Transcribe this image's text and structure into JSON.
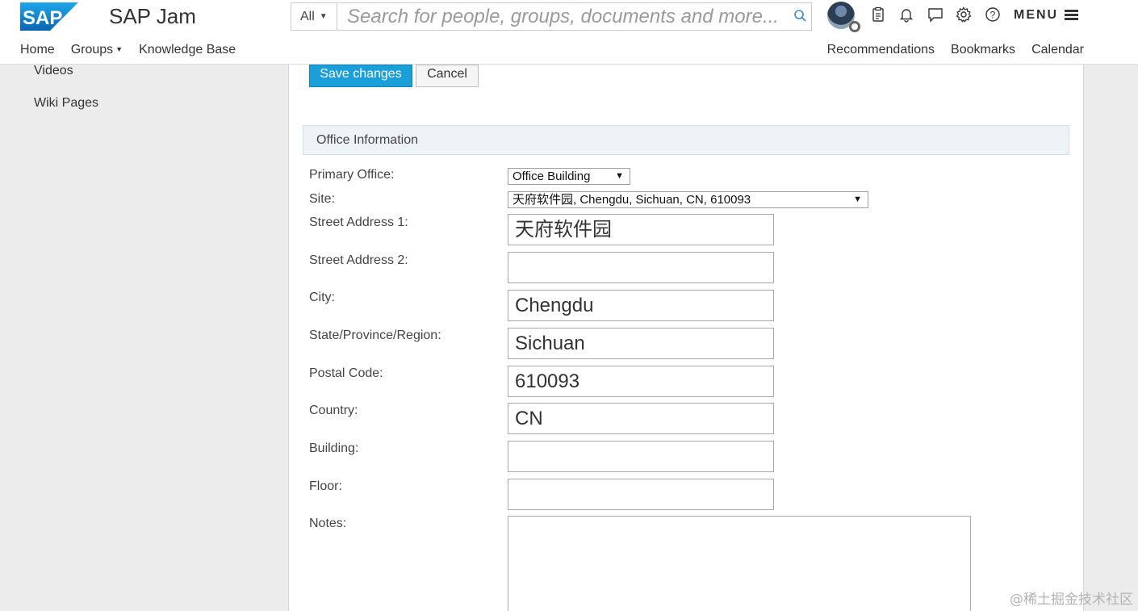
{
  "header": {
    "app_title": "SAP Jam",
    "search_scope": "All",
    "search_placeholder": "Search for people, groups, documents and more...",
    "menu_label": "MENU",
    "icons": [
      "clipboard-icon",
      "bell-icon",
      "chat-icon",
      "gear-icon",
      "help-icon"
    ]
  },
  "nav": {
    "left": [
      "Home",
      "Groups",
      "Knowledge Base"
    ],
    "right": [
      "Recommendations",
      "Bookmarks",
      "Calendar"
    ]
  },
  "sidebar": {
    "items": [
      "Videos",
      "Wiki Pages"
    ]
  },
  "actions": {
    "save_label": "Save changes",
    "cancel_label": "Cancel"
  },
  "section": {
    "title": "Office Information"
  },
  "fields": {
    "primary_office": {
      "label": "Primary Office:",
      "value": "Office Building"
    },
    "site": {
      "label": "Site:",
      "value": "天府软件园, Chengdu, Sichuan, CN, 610093"
    },
    "street1": {
      "label": "Street Address 1:",
      "value": "天府软件园"
    },
    "street2": {
      "label": "Street Address 2:",
      "value": ""
    },
    "city": {
      "label": "City:",
      "value": "Chengdu"
    },
    "state": {
      "label": "State/Province/Region:",
      "value": "Sichuan"
    },
    "postal": {
      "label": "Postal Code:",
      "value": "610093"
    },
    "country": {
      "label": "Country:",
      "value": "CN"
    },
    "building": {
      "label": "Building:",
      "value": ""
    },
    "floor": {
      "label": "Floor:",
      "value": ""
    },
    "notes": {
      "label": "Notes:",
      "value": ""
    }
  },
  "watermark": "@稀土掘金技术社区",
  "colors": {
    "primary_button": "#1a9fd8",
    "section_bg": "#eef3f8",
    "page_bg": "#ececec",
    "logo_blue": "#0f75c3"
  }
}
